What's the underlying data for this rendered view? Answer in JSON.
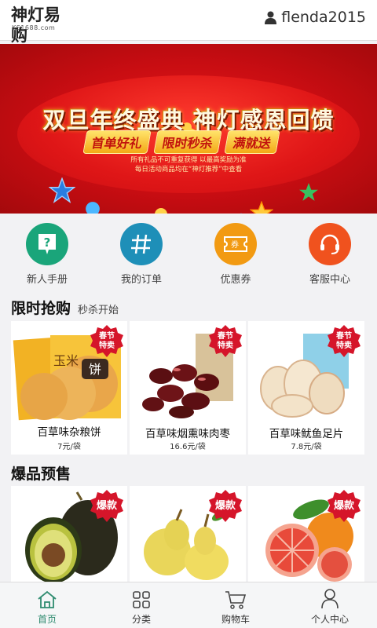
{
  "header": {
    "logo_text": "神灯易购",
    "logo_sub": "KS1688.com",
    "username": "flenda2015"
  },
  "banner": {
    "title": "双旦年终盛典 神灯感恩回馈",
    "tags": [
      "首单好礼",
      "限时秒杀",
      "满就送"
    ],
    "note1": "所有礼品不可重复获得 以最高奖励为准",
    "note2": "每日活动商品均在“神灯推荐”中查看"
  },
  "quicknav": [
    {
      "label": "新人手册",
      "icon": "question-icon",
      "color": "#1aa57a"
    },
    {
      "label": "我的订单",
      "icon": "hash-icon",
      "color": "#1e8fb8"
    },
    {
      "label": "优惠券",
      "icon": "coupon-icon",
      "color": "#f29a12"
    },
    {
      "label": "客服中心",
      "icon": "headset-icon",
      "color": "#f0521e"
    }
  ],
  "flash_sale": {
    "title": "限时抢购",
    "subtitle": "秒杀开始",
    "items": [
      {
        "name": "百草味杂粮饼",
        "price": "7元/袋",
        "badge": "春节\n特卖"
      },
      {
        "name": "百草味烟熏味肉枣",
        "price": "16.6元/袋",
        "badge": "春节\n特卖"
      },
      {
        "name": "百草味鱿鱼足片",
        "price": "7.8元/袋",
        "badge": "春节\n特卖"
      }
    ]
  },
  "hot_preview": {
    "title": "爆品预售",
    "items": [
      {
        "badge": "爆款"
      },
      {
        "badge": "爆款"
      },
      {
        "badge": "爆款"
      }
    ]
  },
  "tabbar": [
    {
      "label": "首页",
      "icon": "home-icon",
      "active": true
    },
    {
      "label": "分类",
      "icon": "grid-icon",
      "active": false
    },
    {
      "label": "购物车",
      "icon": "cart-icon",
      "active": false
    },
    {
      "label": "个人中心",
      "icon": "person-icon",
      "active": false
    }
  ],
  "colors": {
    "accent": "#2e8b6f",
    "badge_red": "#d5152a"
  }
}
